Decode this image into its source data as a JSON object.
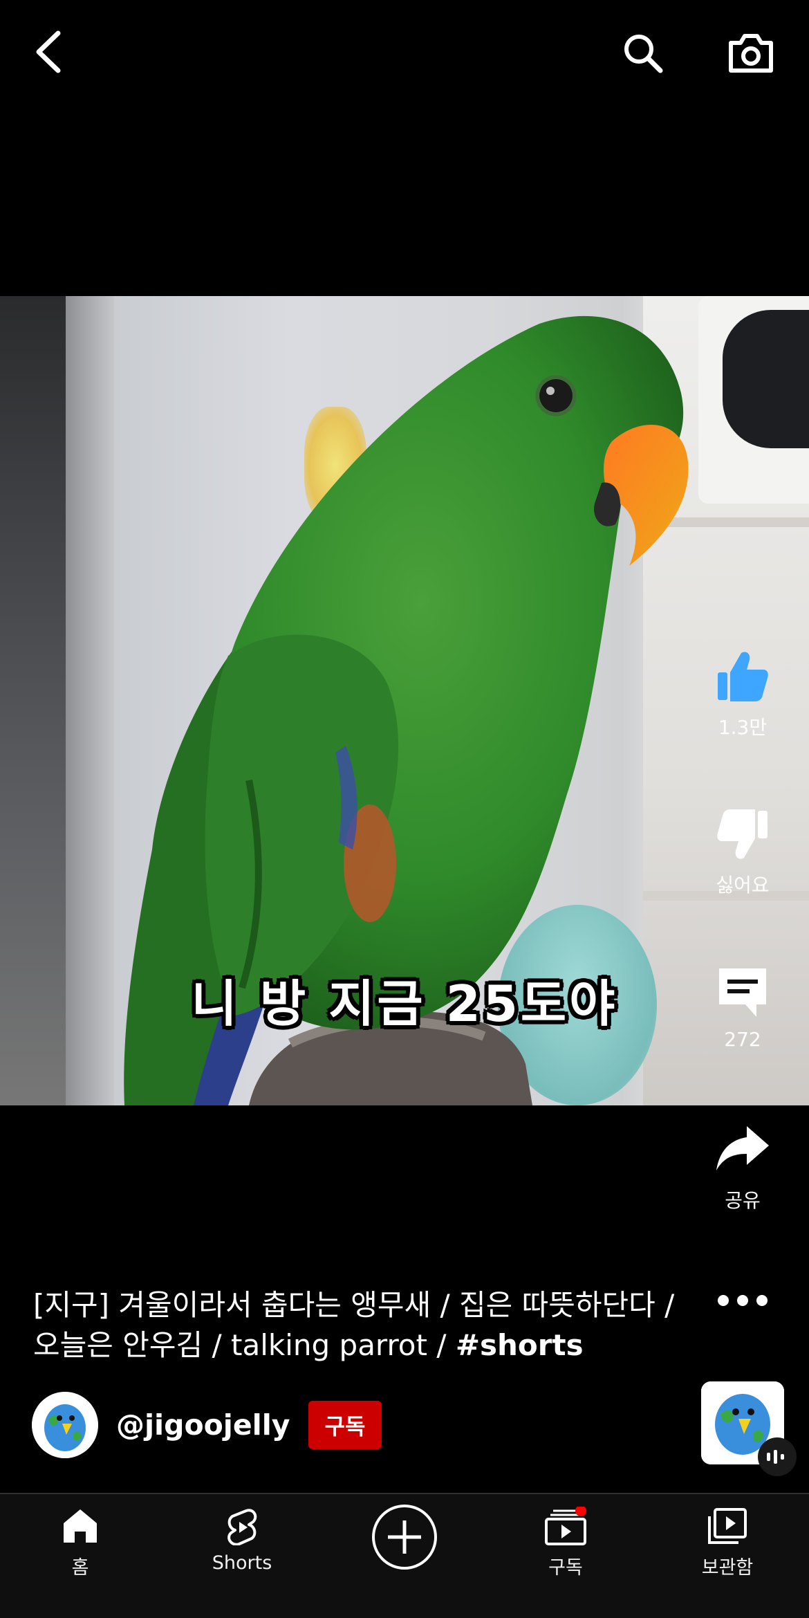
{
  "top_bar": {
    "back_icon": "chevron-left-icon",
    "search_icon": "search-icon",
    "camera_icon": "camera-icon"
  },
  "video": {
    "overlay_caption": "니 방 지금 25도야"
  },
  "actions": {
    "like_count": "1.3만",
    "dislike_label": "싫어요",
    "comment_count": "272",
    "share_label": "공유",
    "more_icon": "more-horizontal-icon"
  },
  "description": {
    "title_text": "[지구] 겨울이라서 춥다는 앵무새 / 집은 따뜻하단다 / 오늘은 안우김 / talking parrot / ",
    "hashtag": "#shorts"
  },
  "channel": {
    "handle": "@jigoojelly",
    "subscribe_label": "구독"
  },
  "bottom_nav": {
    "home": "홈",
    "shorts": "Shorts",
    "subscriptions": "구독",
    "library": "보관함"
  },
  "colors": {
    "accent_red": "#cc0000",
    "like_blue": "#3ea6ff",
    "background": "#000000"
  }
}
